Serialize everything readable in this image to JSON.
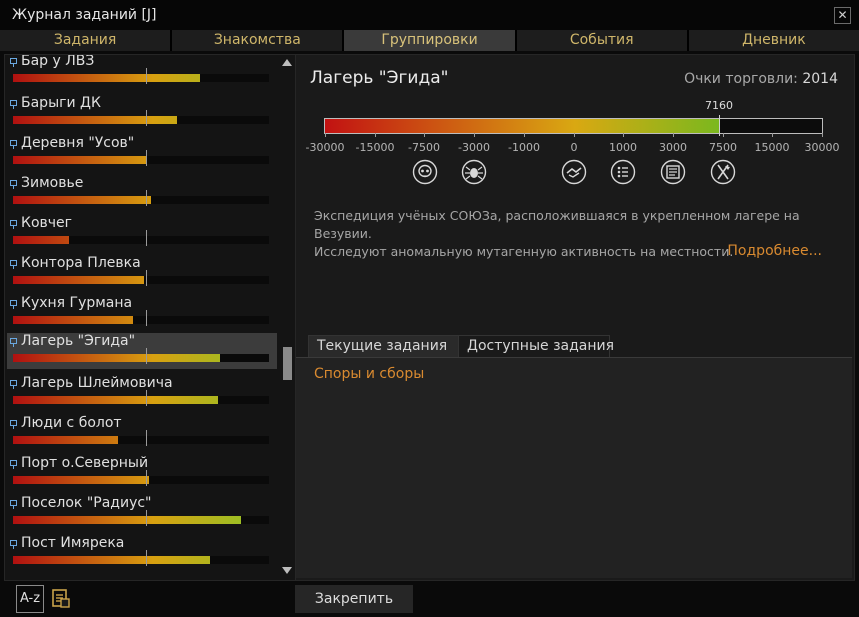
{
  "window": {
    "title": "Журнал заданий [J]"
  },
  "tabs": [
    {
      "label": "Задания"
    },
    {
      "label": "Знакомства"
    },
    {
      "label": "Группировки"
    },
    {
      "label": "События"
    },
    {
      "label": "Дневник"
    }
  ],
  "factions": [
    {
      "name": "Бар у ЛВЗ",
      "fill": 0.73
    },
    {
      "name": "Барыги ДК",
      "fill": 0.64
    },
    {
      "name": "Деревня \"Усов\"",
      "fill": 0.52
    },
    {
      "name": "Зимовье",
      "fill": 0.54
    },
    {
      "name": "Ковчег",
      "fill": 0.22
    },
    {
      "name": "Контора Плевка",
      "fill": 0.51
    },
    {
      "name": "Кухня Гурмана",
      "fill": 0.47
    },
    {
      "name": "Лагерь \"Эгида\"",
      "fill": 0.81
    },
    {
      "name": "Лагерь Шлеймовича",
      "fill": 0.8
    },
    {
      "name": "Люди с болот",
      "fill": 0.41
    },
    {
      "name": "Порт о.Северный",
      "fill": 0.53
    },
    {
      "name": "Поселок \"Радиус\"",
      "fill": 0.89
    },
    {
      "name": "Пост Имярека",
      "fill": 0.77
    }
  ],
  "detail": {
    "faction_name": "Лагерь \"Эгида\"",
    "points_label": "Очки торговли:",
    "points_value": "2014",
    "reputation_value": 7160,
    "reputation_label": "7160",
    "ticks": [
      "-30000",
      "-15000",
      "-7500",
      "-3000",
      "-1000",
      "0",
      "1000",
      "3000",
      "7500",
      "15000",
      "30000"
    ],
    "rank_icons": [
      "skull-icon",
      "spider-icon",
      "handshake-icon",
      "checklist-icon",
      "document-icon",
      "flag-icon"
    ],
    "description_line1": "Экспедиция учёных СОЮЗа, расположившаяся в укрепленном лагере на Везувии.",
    "description_line2": "Исследуют аномальную мутагенную активность на местности.",
    "more_link": "Подробнее...",
    "task_tabs": [
      "Текущие задания",
      "Доступные задания"
    ],
    "tasks": [
      "Споры и сборы"
    ]
  },
  "buttons": {
    "sort": "A-z",
    "pin": "Закрепить"
  }
}
